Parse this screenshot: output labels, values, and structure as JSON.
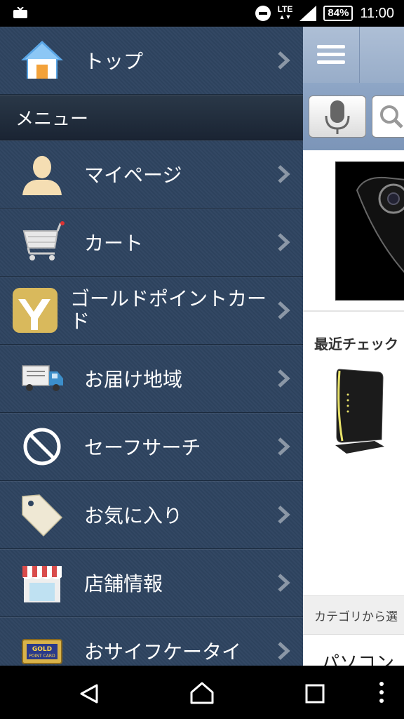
{
  "status_bar": {
    "lte": "LTE",
    "battery": "84%",
    "time": "11:00"
  },
  "drawer": {
    "top_item": "トップ",
    "section_title": "メニュー",
    "items": [
      {
        "label": "マイページ",
        "icon": "person-icon"
      },
      {
        "label": "カート",
        "icon": "cart-icon"
      },
      {
        "label": "ゴールドポイントカード",
        "icon": "gold-point-card-logo-icon"
      },
      {
        "label": "お届け地域",
        "icon": "truck-icon"
      },
      {
        "label": "セーフサーチ",
        "icon": "no-entry-icon"
      },
      {
        "label": "お気に入り",
        "icon": "tag-icon"
      },
      {
        "label": "店舗情報",
        "icon": "store-icon"
      },
      {
        "label": "おサイフケータイ",
        "icon": "point-card-icon"
      }
    ]
  },
  "page": {
    "recent_title": "最近チェック",
    "category_bar": "カテゴリから選",
    "category_item": "パソコン"
  }
}
